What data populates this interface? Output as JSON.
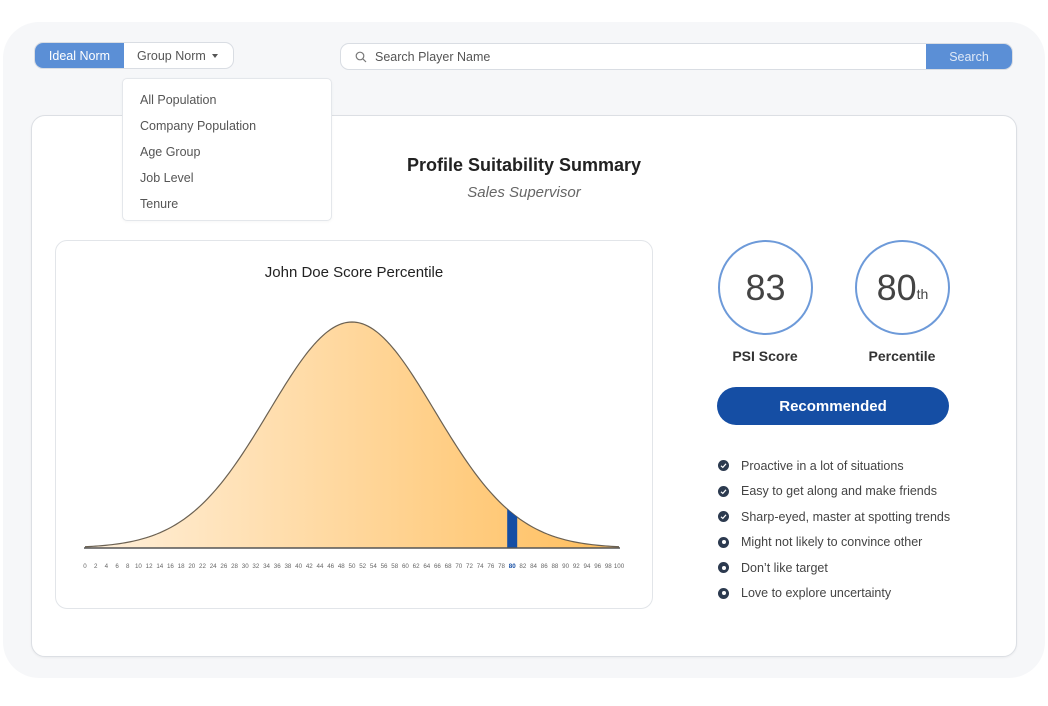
{
  "norm_toggle": {
    "ideal_label": "Ideal Norm",
    "group_label": "Group Norm",
    "active": "Ideal Norm"
  },
  "group_dropdown": {
    "options": [
      "All Population",
      "Company Population",
      "Age Group",
      "Job Level",
      "Tenure"
    ]
  },
  "search": {
    "placeholder": "Search Player Name",
    "value": "",
    "button_label": "Search"
  },
  "summary": {
    "title": "Profile Suitability Summary",
    "subtitle": "Sales Supervisor"
  },
  "scores": {
    "psi_score": "83",
    "psi_label": "PSI Score",
    "percentile": "80",
    "percentile_suffix": "th",
    "percentile_label": "Percentile",
    "status_label": "Recommended"
  },
  "traits": [
    {
      "text": "Proactive in a lot of situations",
      "icon": "check-circle-icon"
    },
    {
      "text": "Easy to get along and make friends",
      "icon": "check-circle-icon"
    },
    {
      "text": "Sharp-eyed, master at spotting trends",
      "icon": "check-circle-icon"
    },
    {
      "text": "Might not likely to convince other",
      "icon": "dot-circle-icon"
    },
    {
      "text": "Don’t like target",
      "icon": "dot-circle-icon"
    },
    {
      "text": "Love to explore uncertainty",
      "icon": "dot-circle-icon"
    }
  ],
  "colors": {
    "accent": "#5b8fd6",
    "primary": "#154ea4",
    "curve_fill_start": "#fff0dc",
    "curve_fill_end": "#ffbe5c",
    "marker": "#154ea4"
  },
  "chart_data": {
    "type": "area",
    "title": "John Doe Score Percentile",
    "distribution": "normal",
    "mean": 50,
    "std_dev": 15.5,
    "x_range": [
      0,
      100
    ],
    "xticks": [
      0,
      2,
      4,
      6,
      8,
      10,
      12,
      14,
      16,
      18,
      20,
      22,
      24,
      26,
      28,
      30,
      32,
      34,
      36,
      38,
      40,
      42,
      44,
      46,
      48,
      50,
      52,
      54,
      56,
      58,
      60,
      62,
      64,
      66,
      68,
      70,
      72,
      74,
      76,
      78,
      80,
      82,
      84,
      86,
      88,
      90,
      92,
      94,
      96,
      98,
      100
    ],
    "highlight_value": 80,
    "highlight_label": "80",
    "xlabel": "",
    "ylabel": "",
    "grid": false,
    "legend": "none"
  }
}
